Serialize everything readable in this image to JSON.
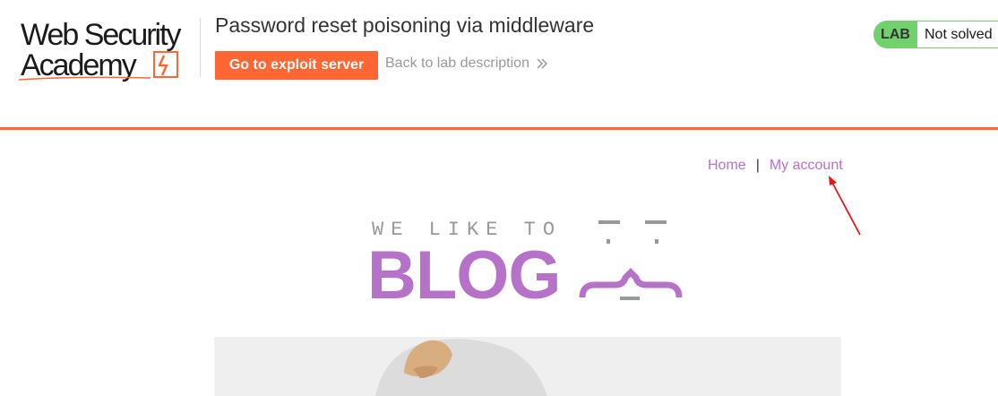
{
  "header": {
    "logo": {
      "line1": "Web Security",
      "line2": "Academy",
      "icon": "lightning-bolt-icon",
      "accent": "#ff6633"
    },
    "lab_title": "Password reset poisoning via middleware",
    "exploit_button": "Go to exploit server",
    "back_link": "Back to lab description",
    "back_icon": "double-chevron-right-icon",
    "status": {
      "tag": "LAB",
      "text": "Not solved",
      "color": "#70d16d"
    }
  },
  "nav": {
    "home": "Home",
    "separator": "|",
    "account": "My account",
    "link_color": "#b572c8"
  },
  "banner": {
    "tagline": "WE LIKE TO",
    "title": "BLOG",
    "face_icon": "curly-face-icon"
  },
  "hero": {
    "image": "hero-image-person"
  },
  "annotation": {
    "icon": "red-arrow-icon",
    "color": "#e3161b"
  }
}
